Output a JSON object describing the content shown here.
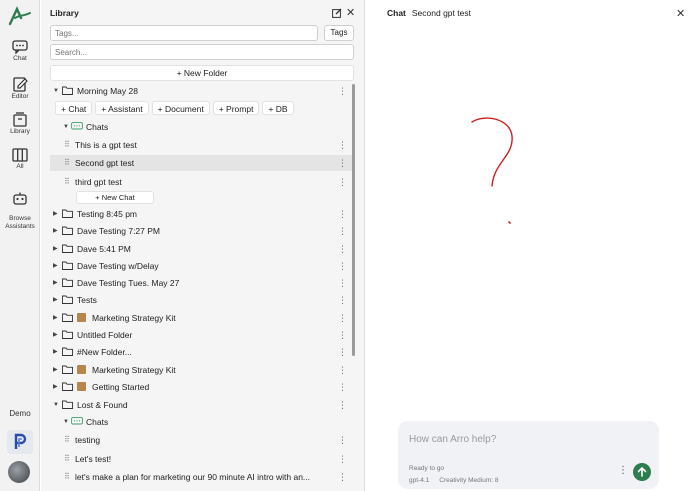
{
  "rail": {
    "items": [
      {
        "label": "Chat",
        "icon": "chat-icon"
      },
      {
        "label": "Editor",
        "icon": "editor-icon"
      },
      {
        "label": "Library",
        "icon": "library-icon"
      },
      {
        "label": "All",
        "icon": "columns-icon"
      },
      {
        "label": "Browse\nAssistants",
        "icon": "robot-icon"
      }
    ],
    "workspace": "Demo",
    "brand_color": "#2e7d4f"
  },
  "library": {
    "title": "Library",
    "tags_placeholder": "Tags...",
    "tags_button": "Tags",
    "search_placeholder": "Search...",
    "new_folder": "+ New Folder",
    "quick_actions": [
      "+ Chat",
      "+ Assistant",
      "+ Document",
      "+ Prompt",
      "+ DB"
    ],
    "chats_label": "Chats",
    "new_chat": "+ New Chat",
    "rows": {
      "morning": "Morning May 28",
      "chat1": "This is a gpt test",
      "chat2": "Second gpt test",
      "chat3": "third gpt test",
      "f1": "Testing 8:45 pm",
      "f2": "Dave Testing 7:27 PM",
      "f3": "Dave 5:41 PM",
      "f4": "Dave Testing w/Delay",
      "f5": "Dave Testing Tues. May 27",
      "f6": "Tests",
      "f7": "Marketing Strategy Kit",
      "f8": "Untitled Folder",
      "f9": "#New Folder...",
      "f10": "Marketing Strategy Kit",
      "f11": "Getting Started",
      "lost": "Lost & Found",
      "lchats": "Chats",
      "l1": "testing",
      "l2": "Let's test!",
      "l3": "let's make a plan for marketing our 90 minute AI intro with an..."
    }
  },
  "chat": {
    "label": "Chat",
    "title": "Second gpt test",
    "placeholder": "How can Arro help?",
    "status": "Ready to go",
    "model": "gpt-4.1",
    "creativity": "Creativity Medium: 8"
  }
}
